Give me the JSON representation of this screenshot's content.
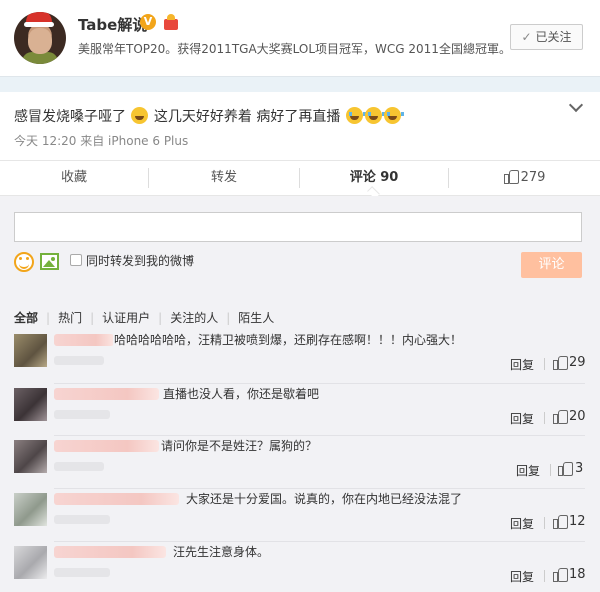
{
  "profile": {
    "name": "Tabe解说",
    "verified_badge": "V",
    "bio": "美服常年TOP20。获得2011TGA大奖赛LOL项目冠军，WCG 2011全国總冠軍。",
    "follow_button": "已关注",
    "follow_check": "✓"
  },
  "post": {
    "text_part1": "感冒发烧嗓子哑了",
    "text_part2": "这几天好好养着 病好了再直播",
    "time": "今天 12:20",
    "source": "来自 iPhone 6 Plus"
  },
  "actions": {
    "favorite": "收藏",
    "forward": "转发",
    "comment": "评论 90",
    "like_count": "279"
  },
  "comment_box": {
    "input_value": "",
    "forward_checkbox_label": "同时转发到我的微博",
    "submit": "评论"
  },
  "filters": [
    {
      "label": "全部",
      "active": true
    },
    {
      "label": "热门",
      "active": false
    },
    {
      "label": "认证用户",
      "active": false
    },
    {
      "label": "关注的人",
      "active": false
    },
    {
      "label": "陌生人",
      "active": false
    }
  ],
  "comments": [
    {
      "text": "哈哈哈哈哈哈，汪精卫被喷到爆，还刷存在感啊！！！内心强大！",
      "reply": "回复",
      "likes": "29"
    },
    {
      "text": "直播也没人看，你还是歇着吧",
      "reply": "回复",
      "likes": "20"
    },
    {
      "text": "请问你是不是姓汪？属狗的？",
      "reply": "回复",
      "likes": "3"
    },
    {
      "text": "大家还是十分爱国。说真的，你在内地已经没法混了",
      "reply": "回复",
      "likes": "12"
    },
    {
      "text": "汪先生注意身体。",
      "reply": "回复",
      "likes": "18"
    }
  ],
  "colors": {
    "accent_orange": "#f2a51a",
    "submit_bg": "#ffc09f",
    "panel_bg": "#f2f2f5",
    "header_band": "#eaf2f7"
  }
}
